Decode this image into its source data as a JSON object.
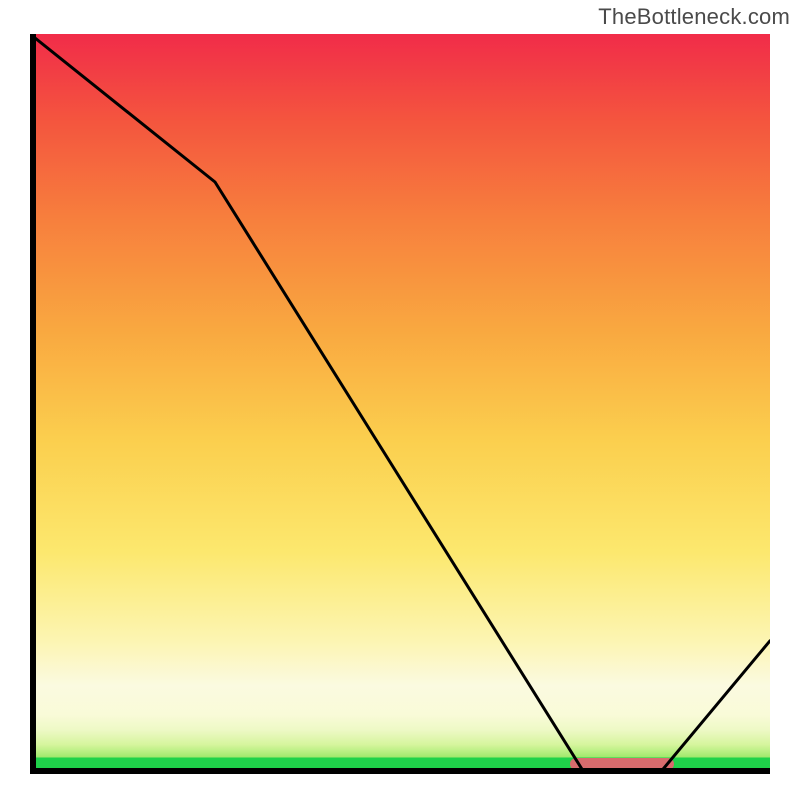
{
  "watermark": "TheBottleneck.com",
  "chart_data": {
    "type": "line",
    "title": "",
    "xlabel": "",
    "ylabel": "",
    "xlim": [
      0,
      100
    ],
    "ylim": [
      0,
      100
    ],
    "x": [
      0,
      25,
      75,
      85,
      100
    ],
    "values": [
      100,
      80,
      0,
      0,
      18
    ],
    "optimum_band": {
      "x_start": 73,
      "x_end": 87
    },
    "background_gradient": {
      "stops": [
        {
          "pos": 0,
          "color": "#f12c49"
        },
        {
          "pos": 50,
          "color": "#fbd24e"
        },
        {
          "pos": 88,
          "color": "#f9fbd8"
        },
        {
          "pos": 97,
          "color": "#9ee86a"
        },
        {
          "pos": 100,
          "color": "#1fd24a"
        }
      ]
    }
  },
  "marker_style": {
    "color": "#d86b6d"
  }
}
